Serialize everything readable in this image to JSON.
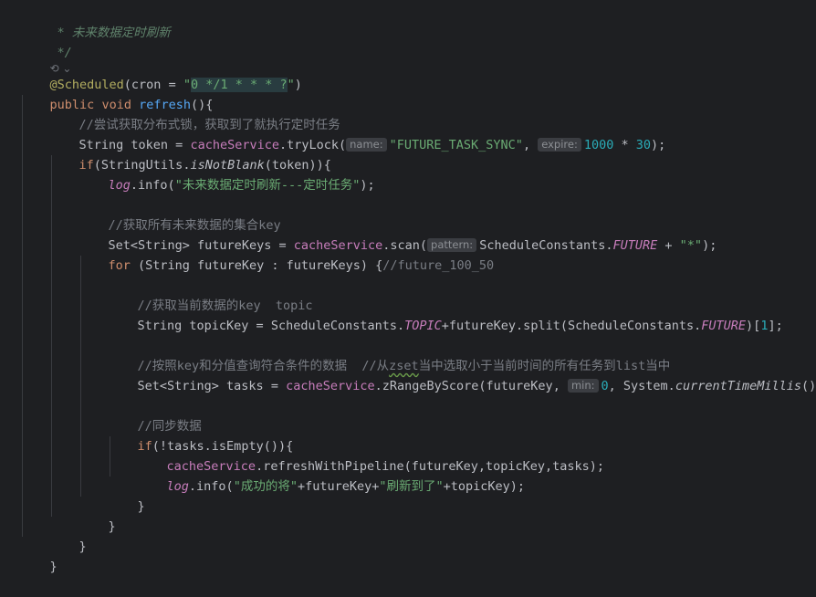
{
  "code": {
    "doc_line": "* 未来数据定时刷新",
    "doc_close": "*/",
    "usage_hint": "⟲ ⌄",
    "annotation": "@Scheduled",
    "ann_args_open": "(cron = ",
    "cron_quote_open": "\"",
    "cron_value": "0 */1 * * * ?",
    "cron_quote_close": "\"",
    "ann_args_close": ")",
    "kw_public": "public",
    "kw_void": "void",
    "method_name": "refresh",
    "method_open": "(){",
    "comment_lock": "//尝试获取分布式锁，获取到了就执行定时任务",
    "token_decl": "String token = ",
    "cache_service": "cacheService",
    "try_lock": ".tryLock(",
    "hint_name": "name:",
    "str_task_sync": "\"FUTURE_TASK_SYNC\"",
    "comma_space": ", ",
    "hint_expire": "expire:",
    "num_1000": "1000",
    "times": " * ",
    "num_30": "30",
    "close_semi": ");",
    "kw_if": "if",
    "if_open": "(StringUtils.",
    "is_not_blank": "isNotBlank",
    "if_token_close": "(token)){",
    "log": "log",
    "info_open": ".info(",
    "str_refresh_task": "\"未来数据定时刷新---定时任务\"",
    "comment_keys": "//获取所有未来数据的集合key",
    "set_decl": "Set<String> futureKeys = ",
    "scan": ".scan(",
    "hint_pattern": "pattern:",
    "schedule_constants": "ScheduleConstants.",
    "future_const": "FUTURE",
    "plus_space": " + ",
    "str_star": "\"*\"",
    "kw_for": "for",
    "for_body": " (String futureKey : futureKeys) {",
    "comment_future": "//future_100_50",
    "comment_topic": "//获取当前数据的key  topic",
    "topic_decl": "String topicKey = ",
    "topic_const": "TOPIC",
    "split_part": "+futureKey.split(ScheduleConstants.",
    "bracket_open": ")[",
    "num_1": "1",
    "bracket_close": "];",
    "comment_query_a": "//按照key和分值查询符合条件的数据  //从",
    "comment_zset": "zset",
    "comment_query_b": "当中选取小于当前时间的所有任务到list当中",
    "tasks_decl": "Set<String> tasks = ",
    "zrange": ".zRangeByScore(futureKey, ",
    "hint_min": "min:",
    "num_0": "0",
    "system_part": ", System.",
    "current_time": "currentTimeMillis",
    "system_close": "());",
    "comment_sync": "//同步数据",
    "if_empty_open": "(!tasks.isEmpty()){",
    "pipeline": ".refreshWithPipeline(futureKey,topicKey,tasks);",
    "str_success": "\"成功的将\"",
    "plus_future": "+futureKey+",
    "str_refreshed": "\"刷新到了\"",
    "plus_topic_close": "+topicKey);",
    "brace": "}"
  },
  "colors": {
    "background": "#1e1f22",
    "keyword": "#cf8e6d",
    "string": "#6aab73",
    "number": "#2aacb8",
    "comment": "#7a7e85",
    "annotation": "#b3ae60",
    "method": "#56a8f5",
    "field": "#c77dbb"
  }
}
